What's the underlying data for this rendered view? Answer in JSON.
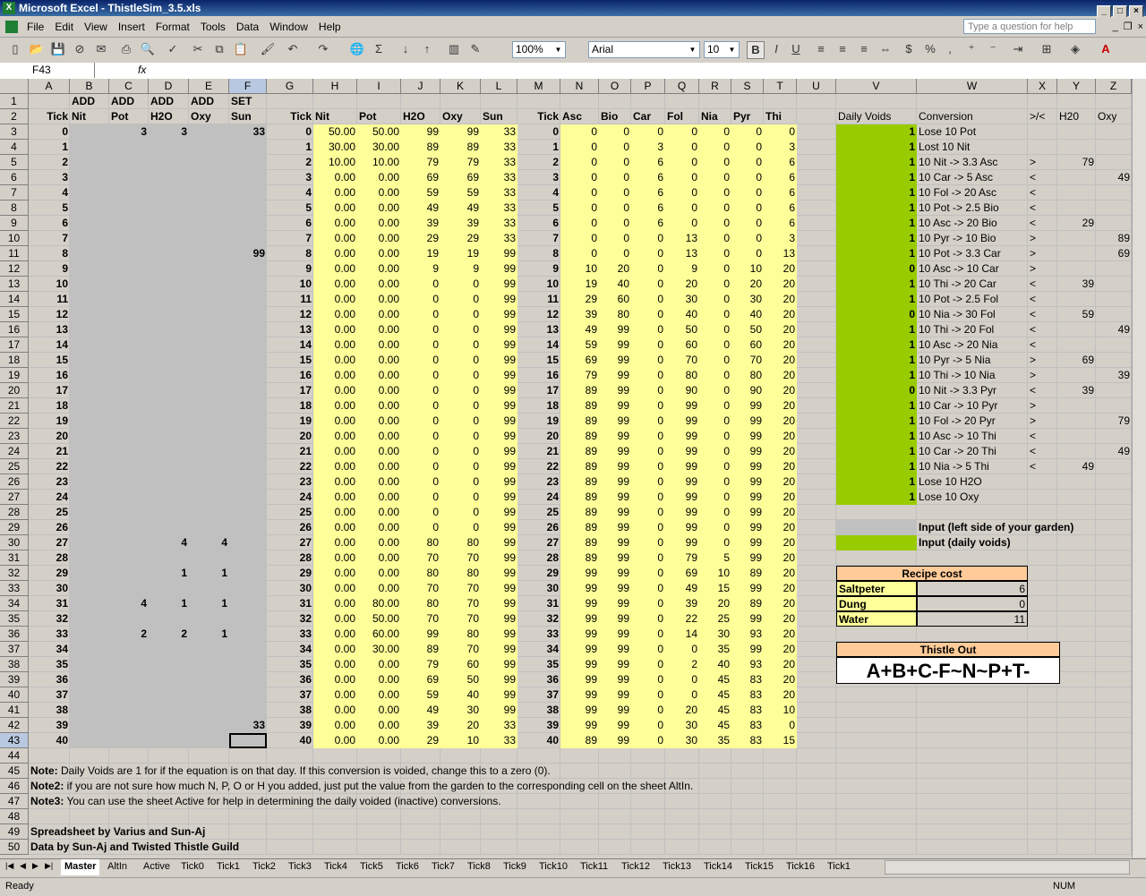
{
  "window": {
    "title": "Microsoft Excel - ThistleSim_3.5.xls",
    "help_placeholder": "Type a question for help"
  },
  "menu": [
    "File",
    "Edit",
    "View",
    "Insert",
    "Format",
    "Tools",
    "Data",
    "Window",
    "Help"
  ],
  "toolbar": {
    "zoom": "100%",
    "font": "Arial",
    "size": "10",
    "bold": "B",
    "italic": "I",
    "underline": "U",
    "currency": "$",
    "percent": "%",
    "comma": ","
  },
  "formula_bar": {
    "name_box": "F43",
    "fx": "fx",
    "content": ""
  },
  "columns": [
    "A",
    "B",
    "C",
    "D",
    "E",
    "F",
    "G",
    "H",
    "I",
    "J",
    "K",
    "L",
    "M",
    "N",
    "O",
    "P",
    "Q",
    "R",
    "S",
    "T",
    "U",
    "V",
    "W",
    "X",
    "Y",
    "Z"
  ],
  "header_row1": {
    "B": "ADD",
    "C": "ADD",
    "D": "ADD",
    "E": "ADD",
    "F": "SET"
  },
  "header_row2": {
    "A": "Tick",
    "B": "Nit",
    "C": "Pot",
    "D": "H2O",
    "E": "Oxy",
    "F": "Sun",
    "G": "Tick",
    "H": "Nit",
    "I": "Pot",
    "J": "H2O",
    "K": "Oxy",
    "L": "Sun",
    "M": "Tick",
    "N": "Asc",
    "O": "Bio",
    "P": "Car",
    "Q": "Fol",
    "R": "Nia",
    "S": "Pyr",
    "T": "Thi",
    "V": "Daily Voids",
    "W": "Conversion",
    "X": ">/<",
    "Y": "H20",
    "Z": "Oxy"
  },
  "rows": [
    {
      "c": "3",
      "d": "3",
      "e": "",
      "f": "33",
      "h": "50.00",
      "i": "50.00",
      "j": "99",
      "k": "99",
      "l": "33",
      "n": "0",
      "o": "0",
      "p": "0",
      "q": "0",
      "r": "0",
      "s": "0",
      "t": "0",
      "v": "1",
      "w": "Lose 10 Pot",
      "x": "",
      "y": "",
      "z": ""
    },
    {
      "c": "",
      "d": "",
      "e": "",
      "f": "",
      "h": "30.00",
      "i": "30.00",
      "j": "89",
      "k": "89",
      "l": "33",
      "n": "0",
      "o": "0",
      "p": "3",
      "q": "0",
      "r": "0",
      "s": "0",
      "t": "3",
      "v": "1",
      "w": "Lost 10 Nit",
      "x": "",
      "y": "",
      "z": ""
    },
    {
      "c": "",
      "d": "",
      "e": "",
      "f": "",
      "h": "10.00",
      "i": "10.00",
      "j": "79",
      "k": "79",
      "l": "33",
      "n": "0",
      "o": "0",
      "p": "6",
      "q": "0",
      "r": "0",
      "s": "0",
      "t": "6",
      "v": "1",
      "w": "10 Nit -> 3.3 Asc",
      "x": ">",
      "y": "79",
      "z": ""
    },
    {
      "c": "",
      "d": "",
      "e": "",
      "f": "",
      "h": "0.00",
      "i": "0.00",
      "j": "69",
      "k": "69",
      "l": "33",
      "n": "0",
      "o": "0",
      "p": "6",
      "q": "0",
      "r": "0",
      "s": "0",
      "t": "6",
      "v": "1",
      "w": "10 Car -> 5 Asc",
      "x": "<",
      "y": "",
      "z": "49"
    },
    {
      "c": "",
      "d": "",
      "e": "",
      "f": "",
      "h": "0.00",
      "i": "0.00",
      "j": "59",
      "k": "59",
      "l": "33",
      "n": "0",
      "o": "0",
      "p": "6",
      "q": "0",
      "r": "0",
      "s": "0",
      "t": "6",
      "v": "1",
      "w": "10 Fol -> 20 Asc",
      "x": "<",
      "y": "",
      "z": ""
    },
    {
      "c": "",
      "d": "",
      "e": "",
      "f": "",
      "h": "0.00",
      "i": "0.00",
      "j": "49",
      "k": "49",
      "l": "33",
      "n": "0",
      "o": "0",
      "p": "6",
      "q": "0",
      "r": "0",
      "s": "0",
      "t": "6",
      "v": "1",
      "w": "10 Pot -> 2.5 Bio",
      "x": "<",
      "y": "",
      "z": ""
    },
    {
      "c": "",
      "d": "",
      "e": "",
      "f": "",
      "h": "0.00",
      "i": "0.00",
      "j": "39",
      "k": "39",
      "l": "33",
      "n": "0",
      "o": "0",
      "p": "6",
      "q": "0",
      "r": "0",
      "s": "0",
      "t": "6",
      "v": "1",
      "w": "10 Asc -> 20 Bio",
      "x": "<",
      "y": "29",
      "z": ""
    },
    {
      "c": "",
      "d": "",
      "e": "",
      "f": "",
      "h": "0.00",
      "i": "0.00",
      "j": "29",
      "k": "29",
      "l": "33",
      "n": "0",
      "o": "0",
      "p": "0",
      "q": "13",
      "r": "0",
      "s": "0",
      "t": "3",
      "v": "1",
      "w": "10 Pyr -> 10 Bio",
      "x": ">",
      "y": "",
      "z": "89"
    },
    {
      "c": "",
      "d": "",
      "e": "",
      "f": "99",
      "h": "0.00",
      "i": "0.00",
      "j": "19",
      "k": "19",
      "l": "99",
      "n": "0",
      "o": "0",
      "p": "0",
      "q": "13",
      "r": "0",
      "s": "0",
      "t": "13",
      "v": "1",
      "w": "10 Pot -> 3.3 Car",
      "x": ">",
      "y": "",
      "z": "69"
    },
    {
      "c": "",
      "d": "",
      "e": "",
      "f": "",
      "h": "0.00",
      "i": "0.00",
      "j": "9",
      "k": "9",
      "l": "99",
      "n": "10",
      "o": "20",
      "p": "0",
      "q": "9",
      "r": "0",
      "s": "10",
      "t": "20",
      "v": "0",
      "w": "10 Asc -> 10 Car",
      "x": ">",
      "y": "",
      "z": ""
    },
    {
      "c": "",
      "d": "",
      "e": "",
      "f": "",
      "h": "0.00",
      "i": "0.00",
      "j": "0",
      "k": "0",
      "l": "99",
      "n": "19",
      "o": "40",
      "p": "0",
      "q": "20",
      "r": "0",
      "s": "20",
      "t": "20",
      "v": "1",
      "w": "10 Thi -> 20 Car",
      "x": "<",
      "y": "39",
      "z": ""
    },
    {
      "c": "",
      "d": "",
      "e": "",
      "f": "",
      "h": "0.00",
      "i": "0.00",
      "j": "0",
      "k": "0",
      "l": "99",
      "n": "29",
      "o": "60",
      "p": "0",
      "q": "30",
      "r": "0",
      "s": "30",
      "t": "20",
      "v": "1",
      "w": "10 Pot -> 2.5 Fol",
      "x": "<",
      "y": "",
      "z": ""
    },
    {
      "c": "",
      "d": "",
      "e": "",
      "f": "",
      "h": "0.00",
      "i": "0.00",
      "j": "0",
      "k": "0",
      "l": "99",
      "n": "39",
      "o": "80",
      "p": "0",
      "q": "40",
      "r": "0",
      "s": "40",
      "t": "20",
      "v": "0",
      "w": "10 Nia -> 30 Fol",
      "x": "<",
      "y": "59",
      "z": ""
    },
    {
      "c": "",
      "d": "",
      "e": "",
      "f": "",
      "h": "0.00",
      "i": "0.00",
      "j": "0",
      "k": "0",
      "l": "99",
      "n": "49",
      "o": "99",
      "p": "0",
      "q": "50",
      "r": "0",
      "s": "50",
      "t": "20",
      "v": "1",
      "w": "10 Thi -> 20 Fol",
      "x": "<",
      "y": "",
      "z": "49"
    },
    {
      "c": "",
      "d": "",
      "e": "",
      "f": "",
      "h": "0.00",
      "i": "0.00",
      "j": "0",
      "k": "0",
      "l": "99",
      "n": "59",
      "o": "99",
      "p": "0",
      "q": "60",
      "r": "0",
      "s": "60",
      "t": "20",
      "v": "1",
      "w": "10 Asc -> 20 Nia",
      "x": "<",
      "y": "",
      "z": ""
    },
    {
      "c": "",
      "d": "",
      "e": "",
      "f": "",
      "h": "0.00",
      "i": "0.00",
      "j": "0",
      "k": "0",
      "l": "99",
      "n": "69",
      "o": "99",
      "p": "0",
      "q": "70",
      "r": "0",
      "s": "70",
      "t": "20",
      "v": "1",
      "w": "10 Pyr -> 5 Nia",
      "x": ">",
      "y": "69",
      "z": ""
    },
    {
      "c": "",
      "d": "",
      "e": "",
      "f": "",
      "h": "0.00",
      "i": "0.00",
      "j": "0",
      "k": "0",
      "l": "99",
      "n": "79",
      "o": "99",
      "p": "0",
      "q": "80",
      "r": "0",
      "s": "80",
      "t": "20",
      "v": "1",
      "w": "10 Thi -> 10 Nia",
      "x": ">",
      "y": "",
      "z": "39"
    },
    {
      "c": "",
      "d": "",
      "e": "",
      "f": "",
      "h": "0.00",
      "i": "0.00",
      "j": "0",
      "k": "0",
      "l": "99",
      "n": "89",
      "o": "99",
      "p": "0",
      "q": "90",
      "r": "0",
      "s": "90",
      "t": "20",
      "v": "0",
      "w": "10 Nit -> 3.3 Pyr",
      "x": "<",
      "y": "39",
      "z": ""
    },
    {
      "c": "",
      "d": "",
      "e": "",
      "f": "",
      "h": "0.00",
      "i": "0.00",
      "j": "0",
      "k": "0",
      "l": "99",
      "n": "89",
      "o": "99",
      "p": "0",
      "q": "99",
      "r": "0",
      "s": "99",
      "t": "20",
      "v": "1",
      "w": "10 Car -> 10 Pyr",
      "x": ">",
      "y": "",
      "z": ""
    },
    {
      "c": "",
      "d": "",
      "e": "",
      "f": "",
      "h": "0.00",
      "i": "0.00",
      "j": "0",
      "k": "0",
      "l": "99",
      "n": "89",
      "o": "99",
      "p": "0",
      "q": "99",
      "r": "0",
      "s": "99",
      "t": "20",
      "v": "1",
      "w": "10 Fol -> 20 Pyr",
      "x": ">",
      "y": "",
      "z": "79"
    },
    {
      "c": "",
      "d": "",
      "e": "",
      "f": "",
      "h": "0.00",
      "i": "0.00",
      "j": "0",
      "k": "0",
      "l": "99",
      "n": "89",
      "o": "99",
      "p": "0",
      "q": "99",
      "r": "0",
      "s": "99",
      "t": "20",
      "v": "1",
      "w": "10 Asc -> 10 Thi",
      "x": "<",
      "y": "",
      "z": ""
    },
    {
      "c": "",
      "d": "",
      "e": "",
      "f": "",
      "h": "0.00",
      "i": "0.00",
      "j": "0",
      "k": "0",
      "l": "99",
      "n": "89",
      "o": "99",
      "p": "0",
      "q": "99",
      "r": "0",
      "s": "99",
      "t": "20",
      "v": "1",
      "w": "10 Car -> 20 Thi",
      "x": "<",
      "y": "",
      "z": "49"
    },
    {
      "c": "",
      "d": "",
      "e": "",
      "f": "",
      "h": "0.00",
      "i": "0.00",
      "j": "0",
      "k": "0",
      "l": "99",
      "n": "89",
      "o": "99",
      "p": "0",
      "q": "99",
      "r": "0",
      "s": "99",
      "t": "20",
      "v": "1",
      "w": "10 Nia -> 5 Thi",
      "x": "<",
      "y": "49",
      "z": ""
    },
    {
      "c": "",
      "d": "",
      "e": "",
      "f": "",
      "h": "0.00",
      "i": "0.00",
      "j": "0",
      "k": "0",
      "l": "99",
      "n": "89",
      "o": "99",
      "p": "0",
      "q": "99",
      "r": "0",
      "s": "99",
      "t": "20",
      "v": "1",
      "w": "Lose 10 H2O",
      "x": "",
      "y": "",
      "z": ""
    },
    {
      "c": "",
      "d": "",
      "e": "",
      "f": "",
      "h": "0.00",
      "i": "0.00",
      "j": "0",
      "k": "0",
      "l": "99",
      "n": "89",
      "o": "99",
      "p": "0",
      "q": "99",
      "r": "0",
      "s": "99",
      "t": "20",
      "v": "1",
      "w": "Lose 10 Oxy",
      "x": "",
      "y": "",
      "z": ""
    },
    {
      "c": "",
      "d": "",
      "e": "",
      "f": "",
      "h": "0.00",
      "i": "0.00",
      "j": "0",
      "k": "0",
      "l": "99",
      "n": "89",
      "o": "99",
      "p": "0",
      "q": "99",
      "r": "0",
      "s": "99",
      "t": "20",
      "v": "",
      "w": "",
      "x": "",
      "y": "",
      "z": ""
    },
    {
      "c": "",
      "d": "",
      "e": "",
      "f": "",
      "h": "0.00",
      "i": "0.00",
      "j": "0",
      "k": "0",
      "l": "99",
      "n": "89",
      "o": "99",
      "p": "0",
      "q": "99",
      "r": "0",
      "s": "99",
      "t": "20",
      "v": "",
      "w": "",
      "x": "",
      "y": "",
      "z": ""
    },
    {
      "c": "",
      "d": "4",
      "e": "4",
      "f": "",
      "h": "0.00",
      "i": "0.00",
      "j": "80",
      "k": "80",
      "l": "99",
      "n": "89",
      "o": "99",
      "p": "0",
      "q": "99",
      "r": "0",
      "s": "99",
      "t": "20",
      "v": "",
      "w": "",
      "x": "",
      "y": "",
      "z": ""
    },
    {
      "c": "",
      "d": "",
      "e": "",
      "f": "",
      "h": "0.00",
      "i": "0.00",
      "j": "70",
      "k": "70",
      "l": "99",
      "n": "89",
      "o": "99",
      "p": "0",
      "q": "79",
      "r": "5",
      "s": "99",
      "t": "20",
      "v": "",
      "w": "",
      "x": "",
      "y": "",
      "z": ""
    },
    {
      "c": "",
      "d": "1",
      "e": "1",
      "f": "",
      "h": "0.00",
      "i": "0.00",
      "j": "80",
      "k": "80",
      "l": "99",
      "n": "99",
      "o": "99",
      "p": "0",
      "q": "69",
      "r": "10",
      "s": "89",
      "t": "20",
      "v": "",
      "w": "",
      "x": "",
      "y": "",
      "z": ""
    },
    {
      "c": "",
      "d": "",
      "e": "",
      "f": "",
      "h": "0.00",
      "i": "0.00",
      "j": "70",
      "k": "70",
      "l": "99",
      "n": "99",
      "o": "99",
      "p": "0",
      "q": "49",
      "r": "15",
      "s": "99",
      "t": "20",
      "v": "",
      "w": "",
      "x": "",
      "y": "",
      "z": ""
    },
    {
      "c": "4",
      "d": "1",
      "e": "1",
      "f": "",
      "h": "0.00",
      "i": "80.00",
      "j": "80",
      "k": "70",
      "l": "99",
      "n": "99",
      "o": "99",
      "p": "0",
      "q": "39",
      "r": "20",
      "s": "89",
      "t": "20",
      "v": "",
      "w": "",
      "x": "",
      "y": "",
      "z": ""
    },
    {
      "c": "",
      "d": "",
      "e": "",
      "f": "",
      "h": "0.00",
      "i": "50.00",
      "j": "70",
      "k": "70",
      "l": "99",
      "n": "99",
      "o": "99",
      "p": "0",
      "q": "22",
      "r": "25",
      "s": "99",
      "t": "20",
      "v": "",
      "w": "",
      "x": "",
      "y": "",
      "z": ""
    },
    {
      "c": "2",
      "d": "2",
      "e": "1",
      "f": "",
      "h": "0.00",
      "i": "60.00",
      "j": "99",
      "k": "80",
      "l": "99",
      "n": "99",
      "o": "99",
      "p": "0",
      "q": "14",
      "r": "30",
      "s": "93",
      "t": "20",
      "v": "",
      "w": "",
      "x": "",
      "y": "",
      "z": ""
    },
    {
      "c": "",
      "d": "",
      "e": "",
      "f": "",
      "h": "0.00",
      "i": "30.00",
      "j": "89",
      "k": "70",
      "l": "99",
      "n": "99",
      "o": "99",
      "p": "0",
      "q": "0",
      "r": "35",
      "s": "99",
      "t": "20",
      "v": "",
      "w": "",
      "x": "",
      "y": "",
      "z": ""
    },
    {
      "c": "",
      "d": "",
      "e": "",
      "f": "",
      "h": "0.00",
      "i": "0.00",
      "j": "79",
      "k": "60",
      "l": "99",
      "n": "99",
      "o": "99",
      "p": "0",
      "q": "2",
      "r": "40",
      "s": "93",
      "t": "20",
      "v": "",
      "w": "",
      "x": "",
      "y": "",
      "z": ""
    },
    {
      "c": "",
      "d": "",
      "e": "",
      "f": "",
      "h": "0.00",
      "i": "0.00",
      "j": "69",
      "k": "50",
      "l": "99",
      "n": "99",
      "o": "99",
      "p": "0",
      "q": "0",
      "r": "45",
      "s": "83",
      "t": "20",
      "v": "",
      "w": "",
      "x": "",
      "y": "",
      "z": ""
    },
    {
      "c": "",
      "d": "",
      "e": "",
      "f": "",
      "h": "0.00",
      "i": "0.00",
      "j": "59",
      "k": "40",
      "l": "99",
      "n": "99",
      "o": "99",
      "p": "0",
      "q": "0",
      "r": "45",
      "s": "83",
      "t": "20",
      "v": "",
      "w": "",
      "x": "",
      "y": "",
      "z": ""
    },
    {
      "c": "",
      "d": "",
      "e": "",
      "f": "",
      "h": "0.00",
      "i": "0.00",
      "j": "49",
      "k": "30",
      "l": "99",
      "n": "99",
      "o": "99",
      "p": "0",
      "q": "20",
      "r": "45",
      "s": "83",
      "t": "10",
      "v": "",
      "w": "",
      "x": "",
      "y": "",
      "z": ""
    },
    {
      "c": "",
      "d": "",
      "e": "",
      "f": "33",
      "h": "0.00",
      "i": "0.00",
      "j": "39",
      "k": "20",
      "l": "33",
      "n": "99",
      "o": "99",
      "p": "0",
      "q": "30",
      "r": "45",
      "s": "83",
      "t": "0",
      "v": "",
      "w": "",
      "x": "",
      "y": "",
      "z": ""
    },
    {
      "c": "",
      "d": "",
      "e": "",
      "f": "",
      "h": "0.00",
      "i": "0.00",
      "j": "29",
      "k": "10",
      "l": "33",
      "n": "89",
      "o": "99",
      "p": "0",
      "q": "30",
      "r": "35",
      "s": "83",
      "t": "15",
      "v": "",
      "w": "",
      "x": "",
      "y": "",
      "z": ""
    }
  ],
  "legend": {
    "gray_label": "Input (left side of your garden)",
    "green_label": "Input (daily voids)"
  },
  "recipe": {
    "title": "Recipe cost",
    "items": [
      {
        "name": "Saltpeter",
        "value": "6"
      },
      {
        "name": "Dung",
        "value": "0"
      },
      {
        "name": "Water",
        "value": "11"
      }
    ]
  },
  "thistle_out": {
    "title": "Thistle Out",
    "value": "A+B+C-F~N~P+T-"
  },
  "notes": [
    {
      "label": "Note:",
      "text": " Daily Voids are 1 for if the equation is on that day.  If this conversion is voided, change this to a zero (0)."
    },
    {
      "label": "Note2:",
      "text": " if you are not sure how much N, P, O or H you added, just put the value from the garden to the corresponding cell on the sheet AltIn."
    },
    {
      "label": "Note3:",
      "text": " You can use the sheet Active for help in determining the daily voided (inactive) conversions."
    }
  ],
  "credits": [
    "Spreadsheet by Varius and Sun-Aj",
    "Data by Sun-Aj and Twisted Thistle Guild"
  ],
  "sheet_tabs": [
    "Master",
    "AltIn",
    "Active",
    "Tick0",
    "Tick1",
    "Tick2",
    "Tick3",
    "Tick4",
    "Tick5",
    "Tick6",
    "Tick7",
    "Tick8",
    "Tick9",
    "Tick10",
    "Tick11",
    "Tick12",
    "Tick13",
    "Tick14",
    "Tick15",
    "Tick16",
    "Tick1"
  ],
  "status": {
    "left": "Ready",
    "right": "NUM"
  },
  "colors": {
    "input_gray": "#c0c0c0",
    "calc_yellow": "#ffff99",
    "voids_green": "#99cc00",
    "header_peach": "#ffcc99"
  }
}
